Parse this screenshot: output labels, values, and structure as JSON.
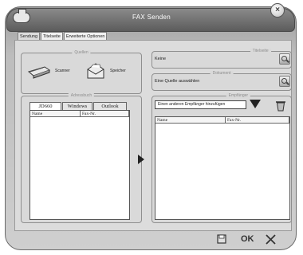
{
  "window": {
    "title": "FAX Senden"
  },
  "tabs": [
    "Sendung",
    "Titelseite",
    "Erweiterte Optionen"
  ],
  "sources": {
    "group_label": "Quellen",
    "scanner_label": "Scanner",
    "memory_label": "Speicher"
  },
  "cover": {
    "group_label": "Titelseite",
    "value": "Keine"
  },
  "document": {
    "group_label": "Dokument",
    "value": "Eine Quelle auswählen"
  },
  "address_book": {
    "group_label": "Adressbuch",
    "tabs": [
      "JD660",
      "Windows",
      "Outlook"
    ],
    "columns": [
      "Name",
      "Fax-Nr."
    ]
  },
  "recipients": {
    "group_label": "Empfänger",
    "combo_value": "Einen anderen Empfänger hinzufügen",
    "columns": [
      "Name",
      "Fax-Nr."
    ]
  },
  "footer": {
    "ok_label": "OK"
  },
  "icons": {
    "app": "fax-icon",
    "close": "close-icon",
    "scanner": "scanner-icon",
    "memory": "envelope-icon",
    "search": "search-icon",
    "add_arrow": "arrow-right-icon",
    "dropdown": "triangle-down-icon",
    "delete": "trash-icon",
    "save": "save-icon",
    "cancel": "x-icon"
  }
}
